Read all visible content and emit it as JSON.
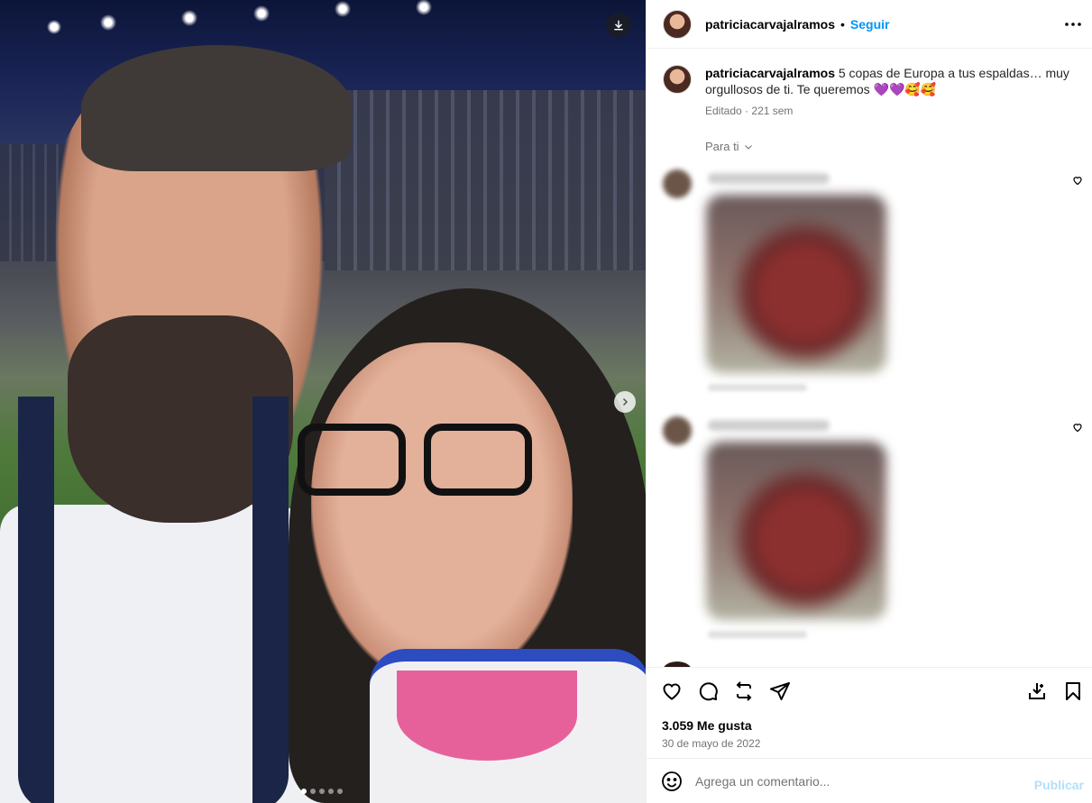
{
  "post": {
    "photo_alt": "",
    "carousel_dots": 5,
    "carousel_active_index": 0
  },
  "header": {
    "username": "patriciacarvajalramos",
    "separator": "•",
    "follow_label": "Seguir"
  },
  "caption": {
    "username": "patriciacarvajalramos",
    "text": "5 copas de Europa a tus espaldas… muy orgullosos de ti. Te queremos 💜💜🥰🥰",
    "edited": "Editado",
    "time_sep": "·",
    "time": "221 sem"
  },
  "comments": {
    "sort_label": "Para ti"
  },
  "actions": {
    "likes": "3.059 Me gusta",
    "date": "30 de mayo de 2022"
  },
  "add_comment": {
    "placeholder": "Agrega un comentario...",
    "publish_label": "Publicar"
  },
  "colors": {
    "accent": "#0095f6",
    "publish_disabled": "#b2dffc",
    "muted_text": "#737373"
  }
}
